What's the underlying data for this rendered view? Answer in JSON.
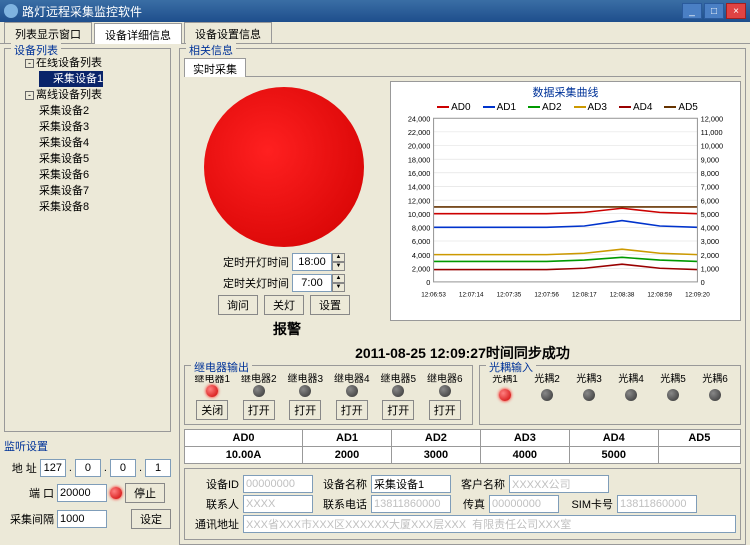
{
  "window": {
    "title": "路灯远程采集监控软件"
  },
  "main_tabs": [
    "列表显示窗口",
    "设备详细信息",
    "设备设置信息"
  ],
  "main_tab_active": 1,
  "left": {
    "device_list_title": "设备列表",
    "tree": {
      "online_label": "在线设备列表",
      "offline_label": "离线设备列表",
      "selected": "采集设备1",
      "offline_items": [
        "采集设备2",
        "采集设备3",
        "采集设备4",
        "采集设备5",
        "采集设备6",
        "采集设备7",
        "采集设备8"
      ]
    },
    "listen_title": "监听设置",
    "addr_label": "地    址",
    "ip": [
      "127",
      "0",
      "0",
      "1"
    ],
    "port_label": "端    口",
    "port_value": "20000",
    "stop_btn": "停止",
    "interval_label": "采集间隔",
    "interval_value": "1000",
    "set_btn": "设定"
  },
  "right": {
    "related_title": "相关信息",
    "realtime_tab": "实时采集",
    "on_time_label": "定时开灯时间",
    "off_time_label": "定时关灯时间",
    "on_time_value": "18:00",
    "off_time_value": "7:00",
    "query_btn": "询问",
    "off_btn": "关灯",
    "set_btn": "设置",
    "alarm_title": "报警"
  },
  "chart_data": {
    "type": "line",
    "title": "数据采集曲线",
    "x_categories": [
      "12:06:53",
      "12:07:14",
      "12:07:35",
      "12:07:56",
      "12:08:17",
      "12:08:38",
      "12:08:59",
      "12:09:20"
    ],
    "left_y": {
      "min": 0,
      "max": 24000,
      "step": 2000
    },
    "right_y": {
      "min": 0,
      "max": 12000,
      "step": 1000
    },
    "series": [
      {
        "name": "AD0",
        "color": "#cc0000",
        "values": [
          10000,
          10000,
          10000,
          10000,
          10200,
          10800,
          10200,
          10000
        ]
      },
      {
        "name": "AD1",
        "color": "#0033cc",
        "values": [
          8000,
          8000,
          8000,
          8000,
          8200,
          9000,
          8200,
          8000
        ]
      },
      {
        "name": "AD2",
        "color": "#009900",
        "values": [
          3000,
          3000,
          3000,
          3000,
          3200,
          3600,
          3200,
          3000
        ]
      },
      {
        "name": "AD3",
        "color": "#cc9900",
        "values": [
          4000,
          4000,
          4000,
          4000,
          4200,
          4800,
          4200,
          4000
        ]
      },
      {
        "name": "AD4",
        "color": "#990000",
        "values": [
          1800,
          1800,
          1800,
          1800,
          2000,
          2600,
          2000,
          1800
        ]
      },
      {
        "name": "AD5",
        "color": "#663300",
        "values": [
          11000,
          11000,
          11000,
          11000,
          11000,
          11000,
          11000,
          11000
        ]
      }
    ]
  },
  "status_line": "2011-08-25 12:09:27时间同步成功",
  "relay": {
    "title": "继电器输出",
    "labels": [
      "继电器1",
      "继电器2",
      "继电器3",
      "继电器4",
      "继电器5",
      "继电器6"
    ],
    "states": [
      true,
      false,
      false,
      false,
      false,
      false
    ],
    "btn_close": "关闭",
    "btn_open": "打开",
    "buttons": [
      "关闭",
      "打开",
      "打开",
      "打开",
      "打开",
      "打开"
    ]
  },
  "optical": {
    "title": "光耦输入",
    "labels": [
      "光耦1",
      "光耦2",
      "光耦3",
      "光耦4",
      "光耦5",
      "光耦6"
    ],
    "states": [
      true,
      false,
      false,
      false,
      false,
      false
    ]
  },
  "ad_table": {
    "headers": [
      "AD0",
      "AD1",
      "AD2",
      "AD3",
      "AD4",
      "AD5"
    ],
    "values": [
      "10.00A",
      "2000",
      "3000",
      "4000",
      "5000",
      ""
    ]
  },
  "info": {
    "dev_id_label": "设备ID",
    "dev_id_value": "00000000",
    "dev_name_label": "设备名称",
    "dev_name_value": "采集设备1",
    "cust_label": "客户名称",
    "cust_value": "XXXXX公司",
    "contact_label": "联系人",
    "contact_value": "XXXX",
    "phone_label": "联系电话",
    "phone_value": "13811860000",
    "fax_label": "传真",
    "fax_value": "00000000",
    "sim_label": "SIM卡号",
    "sim_value": "13811860000",
    "addr_label": "通讯地址",
    "addr_value": "XXX省XXX市XXX区XXXXXX大厦XXX层XXX  有限责任公司XXX室"
  }
}
